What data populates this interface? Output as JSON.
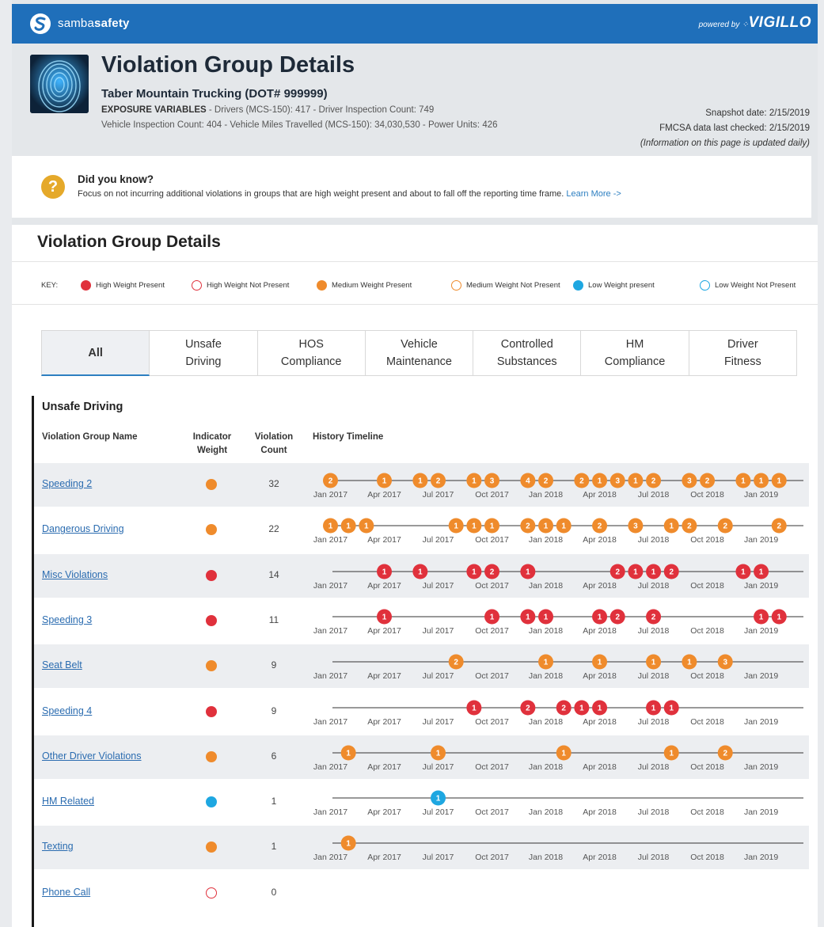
{
  "topbar": {
    "brand_prefix": "samba",
    "brand_suffix": "safety",
    "powered_by": "powered by",
    "vendor": "VIGILLO"
  },
  "header": {
    "title": "Violation Group Details",
    "company": "Taber Mountain Trucking (DOT# 999999)",
    "exposure_label": "EXPOSURE VARIABLES",
    "exposure_text": " - Drivers (MCS-150): 417 - Driver Inspection Count: 749",
    "vehicle_text": "Vehicle Inspection Count: 404 - Vehicle Miles Travelled (MCS-150): 34,030,530 - Power Units: 426",
    "snapshot": "Snapshot date: 2/15/2019",
    "fmcsa": "FMCSA data last checked: 2/15/2019",
    "update_note": "(Information on this page is updated daily)"
  },
  "tip": {
    "title": "Did you know?",
    "body": "Focus on not incurring additional violations in groups that are high weight present and about to fall off the reporting time frame.",
    "link": "Learn More ->"
  },
  "panel": {
    "title": "Violation Group Details",
    "key_label": "KEY:",
    "key": [
      {
        "label": "High Weight Present",
        "color": "#e0313c",
        "filled": true
      },
      {
        "label": "High Weight Not Present",
        "color": "#e0313c",
        "filled": false
      },
      {
        "label": "Medium Weight Present",
        "color": "#ef8b2c",
        "filled": true
      },
      {
        "label": "Medium Weight Not Present",
        "color": "#ef8b2c",
        "filled": false
      },
      {
        "label": "Low Weight present",
        "color": "#1ea7e1",
        "filled": true
      },
      {
        "label": "Low Weight Not Present",
        "color": "#1ea7e1",
        "filled": false
      }
    ],
    "tabs": [
      {
        "l1": "All",
        "l2": ""
      },
      {
        "l1": "Unsafe",
        "l2": "Driving"
      },
      {
        "l1": "HOS",
        "l2": "Compliance"
      },
      {
        "l1": "Vehicle",
        "l2": "Maintenance"
      },
      {
        "l1": "Controlled",
        "l2": "Substances"
      },
      {
        "l1": "HM",
        "l2": "Compliance"
      },
      {
        "l1": "Driver",
        "l2": "Fitness"
      }
    ]
  },
  "section": {
    "title": "Unsafe Driving",
    "col_name": "Violation Group Name",
    "col_weight_1": "Indicator",
    "col_weight_2": "Weight",
    "col_count_1": "Violation",
    "col_count_2": "Count",
    "col_timeline": "History Timeline",
    "axis_labels": [
      "Jan 2017",
      "Apr 2017",
      "Jul 2017",
      "Oct 2017",
      "Jan 2018",
      "Apr 2018",
      "Jul 2018",
      "Oct 2018",
      "Jan 2019"
    ],
    "colors": {
      "high": "#e0313c",
      "medium": "#ef8b2c",
      "low": "#1ea7e1"
    },
    "rows": [
      {
        "name": "Speeding 2",
        "weight": "medium",
        "present": true,
        "count": "32",
        "markers": [
          [
            "Jan 2017",
            "2"
          ],
          [
            "Apr 2017",
            "1"
          ],
          [
            "Jun 2017",
            "1"
          ],
          [
            "Jul 2017",
            "2"
          ],
          [
            "Sep 2017",
            "1"
          ],
          [
            "Oct 2017",
            "3"
          ],
          [
            "Dec 2017",
            "4"
          ],
          [
            "Jan 2018",
            "2"
          ],
          [
            "Mar 2018",
            "2"
          ],
          [
            "Apr 2018",
            "1"
          ],
          [
            "May 2018",
            "3"
          ],
          [
            "Jun 2018",
            "1"
          ],
          [
            "Jul 2018",
            "2"
          ],
          [
            "Sep 2018",
            "3"
          ],
          [
            "Oct 2018",
            "2"
          ],
          [
            "Dec 2018",
            "1"
          ],
          [
            "Jan 2019",
            "1"
          ],
          [
            "Feb 2019",
            "1"
          ]
        ]
      },
      {
        "name": "Dangerous Driving",
        "weight": "medium",
        "present": true,
        "count": "22",
        "markers": [
          [
            "Jan 2017",
            "1"
          ],
          [
            "Feb 2017",
            "1"
          ],
          [
            "Mar 2017",
            "1"
          ],
          [
            "Aug 2017",
            "1"
          ],
          [
            "Sep 2017",
            "1"
          ],
          [
            "Oct 2017",
            "1"
          ],
          [
            "Dec 2017",
            "2"
          ],
          [
            "Jan 2018",
            "1"
          ],
          [
            "Feb 2018",
            "1"
          ],
          [
            "Apr 2018",
            "2"
          ],
          [
            "Jun 2018",
            "3"
          ],
          [
            "Aug 2018",
            "1"
          ],
          [
            "Sep 2018",
            "2"
          ],
          [
            "Nov 2018",
            "2"
          ],
          [
            "Feb 2019",
            "2"
          ]
        ]
      },
      {
        "name": "Misc Violations",
        "weight": "high",
        "present": true,
        "count": "14",
        "markers": [
          [
            "Apr 2017",
            "1"
          ],
          [
            "Jun 2017",
            "1"
          ],
          [
            "Sep 2017",
            "1"
          ],
          [
            "Oct 2017",
            "2"
          ],
          [
            "Dec 2017",
            "1"
          ],
          [
            "May 2018",
            "2"
          ],
          [
            "Jun 2018",
            "1"
          ],
          [
            "Jul 2018",
            "1"
          ],
          [
            "Aug 2018",
            "2"
          ],
          [
            "Dec 2018",
            "1"
          ],
          [
            "Jan 2019",
            "1"
          ]
        ]
      },
      {
        "name": "Speeding 3",
        "weight": "high",
        "present": true,
        "count": "11",
        "markers": [
          [
            "Apr 2017",
            "1"
          ],
          [
            "Oct 2017",
            "1"
          ],
          [
            "Dec 2017",
            "1"
          ],
          [
            "Jan 2018",
            "1"
          ],
          [
            "Apr 2018",
            "1"
          ],
          [
            "May 2018",
            "2"
          ],
          [
            "Jul 2018",
            "2"
          ],
          [
            "Jan 2019",
            "1"
          ],
          [
            "Feb 2019",
            "1"
          ]
        ]
      },
      {
        "name": "Seat Belt",
        "weight": "medium",
        "present": true,
        "count": "9",
        "markers": [
          [
            "Aug 2017",
            "2"
          ],
          [
            "Jan 2018",
            "1"
          ],
          [
            "Apr 2018",
            "1"
          ],
          [
            "Jul 2018",
            "1"
          ],
          [
            "Sep 2018",
            "1"
          ],
          [
            "Nov 2018",
            "3"
          ]
        ]
      },
      {
        "name": "Speeding 4",
        "weight": "high",
        "present": true,
        "count": "9",
        "markers": [
          [
            "Sep 2017",
            "1"
          ],
          [
            "Dec 2017",
            "2"
          ],
          [
            "Feb 2018",
            "2"
          ],
          [
            "Mar 2018",
            "1"
          ],
          [
            "Apr 2018",
            "1"
          ],
          [
            "Jul 2018",
            "1"
          ],
          [
            "Aug 2018",
            "1"
          ]
        ]
      },
      {
        "name": "Other Driver Violations",
        "weight": "medium",
        "present": true,
        "count": "6",
        "markers": [
          [
            "Feb 2017",
            "1"
          ],
          [
            "Jul 2017",
            "1"
          ],
          [
            "Feb 2018",
            "1"
          ],
          [
            "Aug 2018",
            "1"
          ],
          [
            "Nov 2018",
            "2"
          ]
        ]
      },
      {
        "name": "HM Related",
        "weight": "low",
        "present": true,
        "count": "1",
        "markers": [
          [
            "Jul 2017",
            "1"
          ]
        ]
      },
      {
        "name": "Texting",
        "weight": "medium",
        "present": true,
        "count": "1",
        "markers": [
          [
            "Feb 2017",
            "1"
          ]
        ]
      },
      {
        "name": "Phone Call",
        "weight": "high",
        "present": false,
        "count": "0",
        "markers": []
      }
    ]
  }
}
